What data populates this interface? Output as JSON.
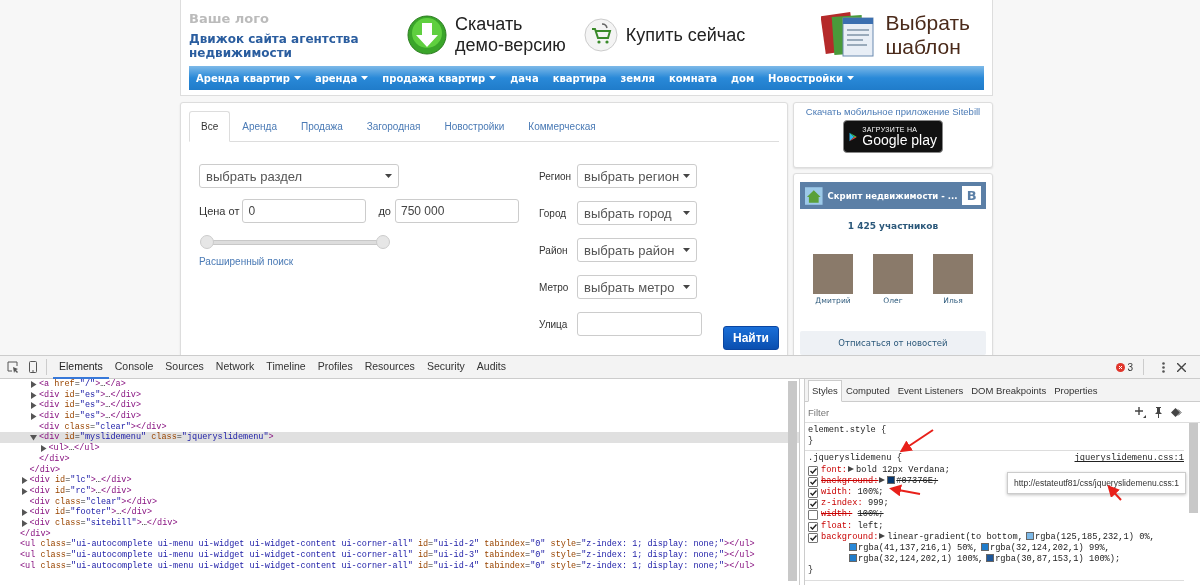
{
  "page": {
    "header": {
      "logo_placeholder": "Ваше лого",
      "site_title": "Движок сайта агентства недвижимости",
      "promos": [
        {
          "kind": "download",
          "label": "Скачать\nдемо-версию"
        },
        {
          "kind": "cart",
          "label": "Купить сейчас"
        },
        {
          "kind": "templates",
          "label": "Выбрать\nшаблон"
        }
      ]
    },
    "nav": [
      {
        "label": "Аренда квартир",
        "dropdown": true
      },
      {
        "label": "аренда",
        "dropdown": true
      },
      {
        "label": "продажа квартир",
        "dropdown": true
      },
      {
        "label": "дача",
        "dropdown": false
      },
      {
        "label": "квартира",
        "dropdown": false
      },
      {
        "label": "земля",
        "dropdown": false
      },
      {
        "label": "комната",
        "dropdown": false
      },
      {
        "label": "дом",
        "dropdown": false
      },
      {
        "label": "Новостройки",
        "dropdown": true
      }
    ],
    "search": {
      "tabs": [
        {
          "label": "Все",
          "selected": true
        },
        {
          "label": "Аренда",
          "selected": false
        },
        {
          "label": "Продажа",
          "selected": false
        },
        {
          "label": "Загородная",
          "selected": false
        },
        {
          "label": "Новостройки",
          "selected": false
        },
        {
          "label": "Коммерческая",
          "selected": false
        }
      ],
      "section_select": "выбрать раздел",
      "price_from_label": "Цена от",
      "price_from": "0",
      "price_to_label": "до",
      "price_to": "750 000",
      "price_slider": {
        "thumbs": [
          {
            "level": 0
          },
          {
            "level": 1
          }
        ]
      },
      "advanced_link": "Расширенный поиск",
      "location_fields": [
        {
          "kind": "select",
          "label": "Регион",
          "value": "выбрать регион"
        },
        {
          "kind": "select",
          "label": "Город",
          "value": "выбрать город"
        },
        {
          "kind": "select",
          "label": "Район",
          "value": "выбрать район"
        },
        {
          "kind": "select",
          "label": "Метро",
          "value": "выбрать метро"
        },
        {
          "kind": "input",
          "label": "Улица"
        }
      ],
      "submit": "Найти"
    },
    "sidebar": {
      "app_link": "Скачать мобильное приложение Sitebill",
      "store_badge": {
        "caption": "ЗАГРУЗИТЕ НА",
        "store": "Google play"
      },
      "vk_widget": {
        "title": "Скрипт недвижимости - ...",
        "logo": "В",
        "members_count": "1 425 участников",
        "members": [
          {
            "name": "Дмитрий"
          },
          {
            "name": "Олег"
          },
          {
            "name": "Илья"
          }
        ],
        "unsubscribe": "Отписаться от новостей"
      }
    }
  },
  "devtools": {
    "tabs": [
      {
        "label": "Elements",
        "selected": true
      },
      {
        "label": "Console",
        "selected": false
      },
      {
        "label": "Sources",
        "selected": false
      },
      {
        "label": "Network",
        "selected": false
      },
      {
        "label": "Timeline",
        "selected": false
      },
      {
        "label": "Profiles",
        "selected": false
      },
      {
        "label": "Resources",
        "selected": false
      },
      {
        "label": "Security",
        "selected": false
      },
      {
        "label": "Audits",
        "selected": false
      }
    ],
    "error_count": "3",
    "dom_tree": [
      {
        "children": [
          {
            "children": [
              {
                "text": "<a href=\"/\">…</a>",
                "expanded": false,
                "selected": false
              },
              {
                "text": "<div id=\"es\">…</div>",
                "expanded": false,
                "selected": false
              },
              {
                "text": "<div id=\"es\">…</div>",
                "expanded": false,
                "selected": false
              },
              {
                "text": "<div id=\"es\">…</div>",
                "expanded": false,
                "selected": false
              },
              {
                "text": "<div class=\"clear\"></div>",
                "selected": false
              },
              {
                "text": "<div id=\"myslidemenu\" class=\"jqueryslidemenu\">",
                "expanded": true,
                "selected": true,
                "children": [
                  {
                    "text": "<ul>…</ul>",
                    "expanded": false,
                    "selected": false
                  }
                ],
                "closing": "</div>"
              }
            ],
            "closing": "</div>"
          },
          {
            "text": "<div id=\"lc\">…</div>",
            "expanded": false,
            "selected": false
          },
          {
            "text": "<div id=\"rc\">…</div>",
            "expanded": false,
            "selected": false
          },
          {
            "text": "<div class=\"clear\"></div>",
            "selected": false
          },
          {
            "text": "<div id=\"footer\">…</div>",
            "expanded": false,
            "selected": false
          },
          {
            "text": "<div class=\"sitebill\">…</div>",
            "expanded": false,
            "selected": false
          }
        ],
        "closing": "</div>"
      },
      {
        "text": "<ul class=\"ui-autocomplete ui-menu ui-widget ui-widget-content ui-corner-all\" id=\"ui-id-2\" tabindex=\"0\" style=\"z-index: 1; display: none;\"></ul>",
        "selected": false
      },
      {
        "text": "<ul class=\"ui-autocomplete ui-menu ui-widget ui-widget-content ui-corner-all\" id=\"ui-id-3\" tabindex=\"0\" style=\"z-index: 1; display: none;\"></ul>",
        "selected": false
      },
      {
        "text": "<ul class=\"ui-autocomplete ui-menu ui-widget ui-widget-content ui-corner-all\" id=\"ui-id-4\" tabindex=\"0\" style=\"z-index: 1; display: none;\"></ul>",
        "selected": false
      }
    ],
    "styles_tabs": [
      {
        "label": "Styles",
        "selected": true
      },
      {
        "label": "Computed",
        "selected": false
      },
      {
        "label": "Event Listeners",
        "selected": false
      },
      {
        "label": "DOM Breakpoints",
        "selected": false
      },
      {
        "label": "Properties",
        "selected": false
      }
    ],
    "filter_placeholder": "Filter",
    "rules": [
      {
        "selector": "element.style {",
        "closing": "}"
      },
      {
        "selector": ".jqueryslidemenu {",
        "source": "jqueryslidemenu.css:1",
        "closing": "}",
        "properties": [
          {
            "name": "font:",
            "checked": true,
            "overridden": false,
            "expandable": true,
            "value_parts": [
              {
                "text": "bold 12px Verdana;"
              }
            ]
          },
          {
            "name": "background:",
            "checked": true,
            "overridden": true,
            "expandable": true,
            "value_parts": [
              {
                "color": "#07376e",
                "text": "#07376E;"
              }
            ]
          },
          {
            "name": "width:",
            "checked": true,
            "overridden": false,
            "value_parts": [
              {
                "text": "100%;"
              }
            ]
          },
          {
            "name": "z-index:",
            "checked": true,
            "overridden": false,
            "value_parts": [
              {
                "text": "999;"
              }
            ]
          },
          {
            "name": "width:",
            "checked": false,
            "overridden": true,
            "value_parts": [
              {
                "text": "100%;"
              }
            ]
          },
          {
            "name": "float:",
            "checked": true,
            "overridden": false,
            "value_parts": [
              {
                "text": "left;"
              }
            ]
          },
          {
            "name": "background:",
            "checked": true,
            "overridden": false,
            "expandable": true,
            "value_parts": [
              {
                "text": "linear-gradient(to bottom,"
              },
              {
                "color": "#7db9e8",
                "text": "rgba(125,185,232,1) 0%,"
              },
              {
                "color": "#2989d8",
                "text": "rgba(41,137,216,1) 50%,"
              },
              {
                "color": "#207cca",
                "text": "rgba(32,124,202,1) 99%,"
              },
              {
                "color": "#207cca",
                "text": "rgba(32,124,202,1) 100%,"
              },
              {
                "color": "#1e5799",
                "text": "rgba(30,87,153,1) 100%);"
              }
            ]
          }
        ]
      }
    ],
    "tooltip": "http://estateutf81/css/jqueryslidemenu.css:1"
  }
}
